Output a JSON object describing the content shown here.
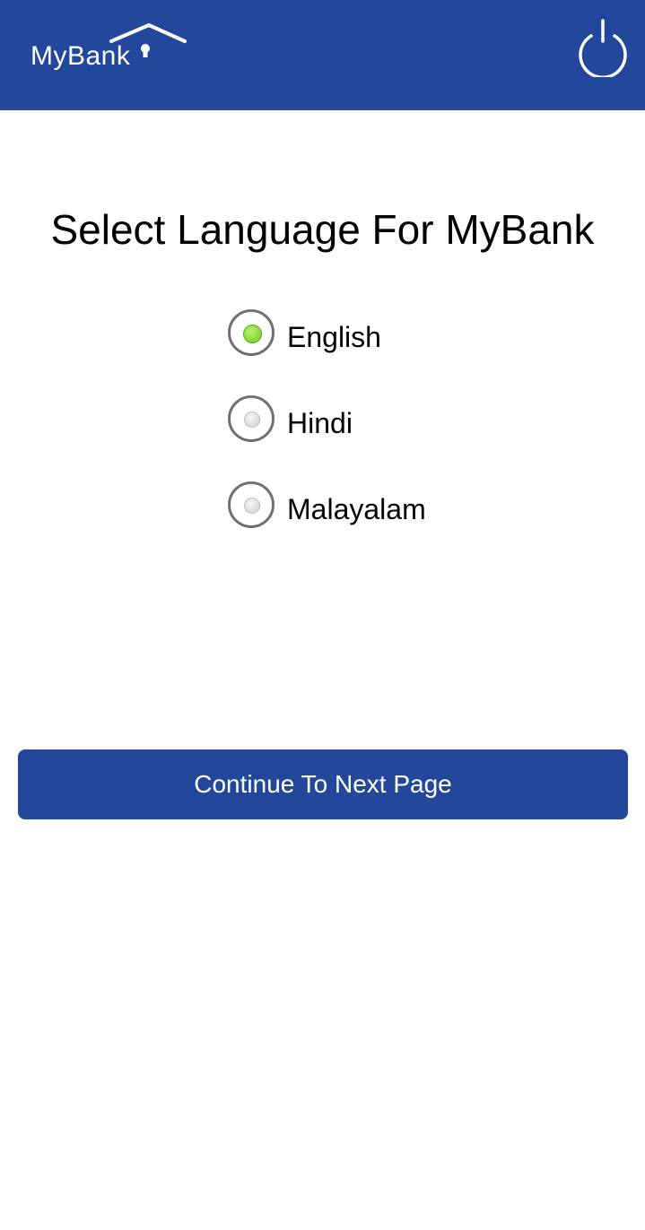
{
  "header": {
    "logo_text": "MyBank",
    "background_color": "#22479b",
    "power_icon": "power-icon"
  },
  "main": {
    "title": "Select Language For MyBank",
    "languages": [
      {
        "label": "English",
        "selected": true
      },
      {
        "label": "Hindi",
        "selected": false
      },
      {
        "label": "Malayalam",
        "selected": false
      }
    ],
    "continue_label": "Continue To Next Page",
    "selected_color": "#7cd428"
  }
}
